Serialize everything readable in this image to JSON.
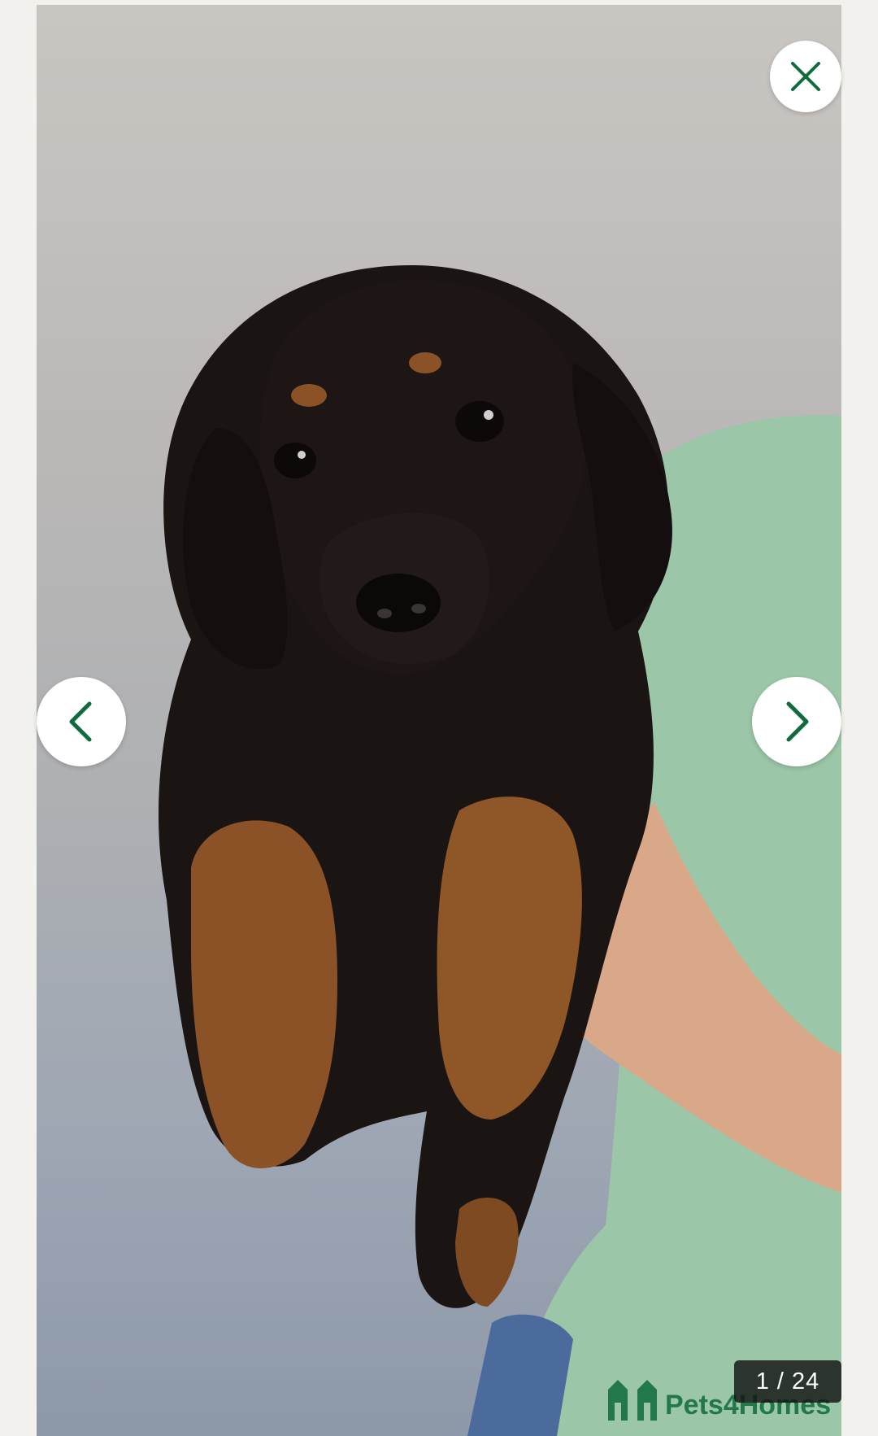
{
  "gallery": {
    "counter_current": "1",
    "counter_separator": "/",
    "counter_total": "24",
    "counter_text": "1 / 24",
    "photo_alt": "Black and tan puppy held in hands",
    "watermark_text": "Pets4Homes"
  },
  "controls": {
    "close_icon": "close-icon",
    "prev_icon": "chevron-left-icon",
    "next_icon": "chevron-right-icon"
  },
  "colors": {
    "accent": "#0e6b3b",
    "button_bg": "#ffffff",
    "counter_bg": "#141414"
  }
}
